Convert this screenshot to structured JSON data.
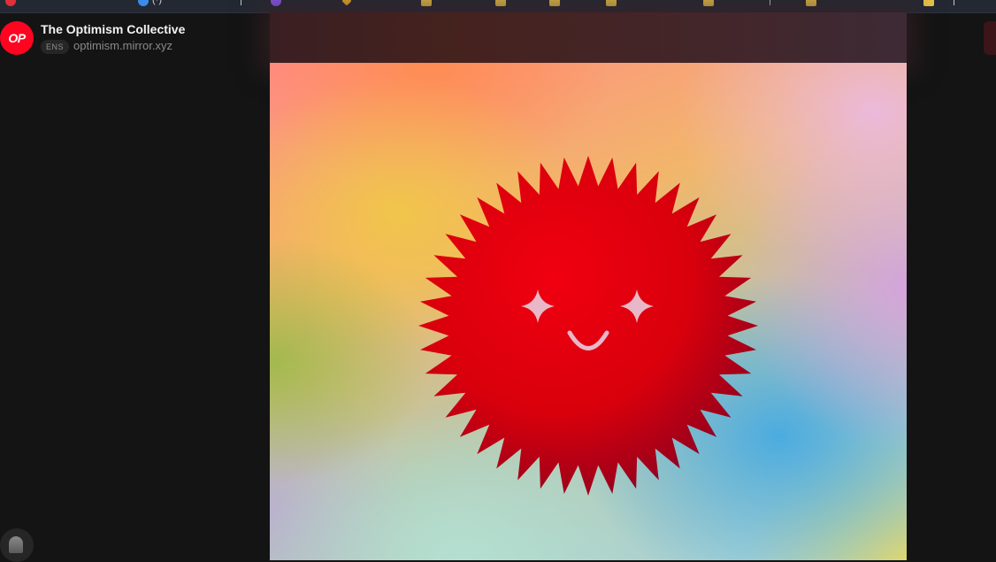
{
  "publication": {
    "name": "The Optimism Collective",
    "logo_text": "OP",
    "ens_label": "ENS",
    "domain": "optimism.mirror.xyz"
  },
  "bookmarks": {
    "partial_text": "(·)"
  },
  "hero": {
    "subject": "sun-mascot",
    "colors": {
      "sun": "#e8000f",
      "brand": "#ff0420"
    }
  }
}
